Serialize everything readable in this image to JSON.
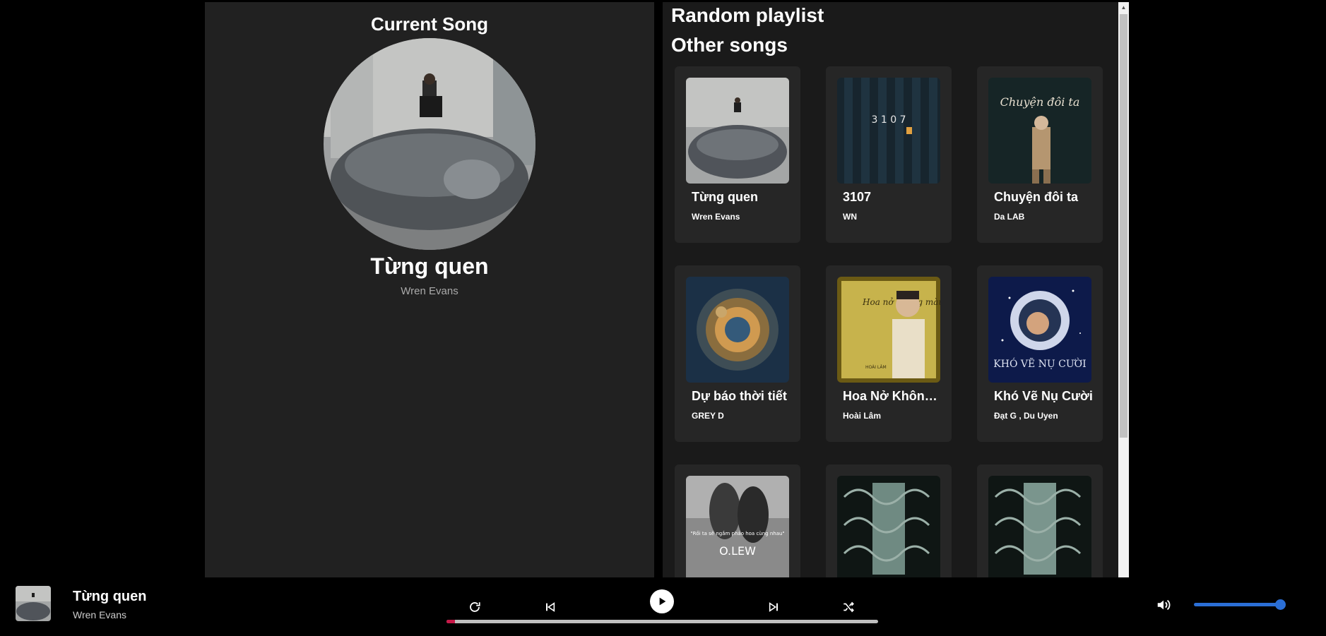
{
  "current": {
    "heading": "Current Song",
    "title": "Từng quen",
    "artist": "Wren Evans"
  },
  "playlist": {
    "heading": "Random playlist",
    "subheading": "Other songs",
    "songs": [
      {
        "title": "Từng quen",
        "artist": "Wren Evans"
      },
      {
        "title": "3107",
        "artist": "WN"
      },
      {
        "title": "Chuyện đôi ta",
        "artist": "Da LAB"
      },
      {
        "title": "Dự báo thời tiết",
        "artist": "GREY D"
      },
      {
        "title": "Hoa Nở Không Màu",
        "artist": "Hoài Lâm"
      },
      {
        "title": "Khó Vẽ Nụ Cười",
        "artist": "Đạt G , Du Uyen"
      },
      {
        "title": "",
        "artist": ""
      },
      {
        "title": "",
        "artist": ""
      },
      {
        "title": "",
        "artist": ""
      }
    ],
    "art_text": {
      "a3107": "3 1 0 7",
      "chuyen": "Chuyện đôi ta",
      "hoa": "Hoa nở không màu",
      "hoa_small": "HOÀI LÂM",
      "kho": "KHÓ VẼ NỤ CƯỜI",
      "olew_quote": "\"Rồi ta sẽ ngắm pháo hoa cùng nhau\"",
      "olew_name": "O.LEW"
    }
  },
  "player": {
    "title": "Từng quen",
    "artist": "Wren Evans",
    "progress": 0.02,
    "volume": 0.96
  },
  "colors": {
    "panel": "#212121",
    "card": "#262626",
    "progress": "#c81848",
    "volume": "#2b6fd6"
  }
}
